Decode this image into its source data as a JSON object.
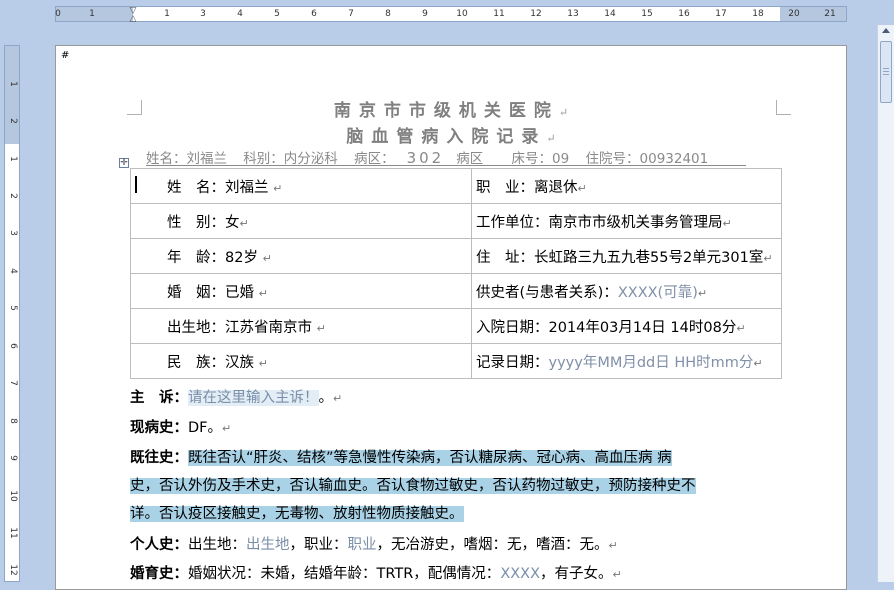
{
  "ruler": {
    "h_numbers": [
      "0",
      "1",
      "2",
      "1",
      "2",
      "3",
      "4",
      "5",
      "6",
      "7",
      "8",
      "9",
      "10",
      "11",
      "12",
      "13",
      "14",
      "15",
      "16",
      "17",
      "18",
      "19",
      "20",
      "21"
    ],
    "v_numbers": [
      "1",
      "2",
      "1",
      "2",
      "3",
      "4",
      "5",
      "6",
      "7",
      "8",
      "9",
      "10",
      "11",
      "12",
      "13"
    ]
  },
  "page": {
    "hash": "#",
    "title_line1": "南京市市级机关医院",
    "title_line2": "脑血管病入院记录",
    "return_mark": "↵",
    "info": {
      "name": "姓名：刘福兰",
      "dept": "科别：内分泌科",
      "ward_label": "病区：",
      "ward_value": "302",
      "ward_suffix": "病区",
      "bed": "床号：09",
      "admission_no": "住院号：00932401"
    },
    "table": [
      {
        "left_label": "姓　名：",
        "left_value": "刘福兰",
        "right_label": "职　业：",
        "right_value": "离退休"
      },
      {
        "left_label": "性　别：",
        "left_value": "女",
        "right_label": "工作单位：",
        "right_value": "南京市市级机关事务管理局"
      },
      {
        "left_label": "年　龄：",
        "left_value": "82岁",
        "right_label": "住　址：",
        "right_value": "长虹路三九五九巷55号2单元301室"
      },
      {
        "left_label": "婚　姻：",
        "left_value": "已婚",
        "right_label": "供史者(与患者关系)：",
        "right_value": "XXXX(可靠)"
      },
      {
        "left_label": "出生地：",
        "left_value": "江苏省南京市",
        "right_label": "入院日期：",
        "right_value": "2014年03月14日 14时08分"
      },
      {
        "left_label": "民　族：",
        "left_value": "汉族",
        "right_label": "记录日期：",
        "right_value": "yyyy年MM月dd日 HH时mm分"
      }
    ],
    "chief_complaint": {
      "label": "主　诉：",
      "placeholder": "请在这里输入主诉！",
      "tail": "。"
    },
    "present_history": {
      "label": "现病史：",
      "value": "DF。"
    },
    "past_history": {
      "label": "既往史：",
      "line1": "既往否认“肝炎、结核”等急慢性传染病，否认糖尿病、冠心病、高血压病 病",
      "line2": "史，否认外伤及手术史，否认输血史。否认食物过敏史，否认药物过敏史，预防接种史不",
      "line3": "详。否认疫区接触史，无毒物、放射性物质接触史。"
    },
    "personal_history": {
      "label": "个人史：",
      "birthplace_label": "出生地：",
      "birthplace_value": "出生地",
      "occupation_label": "，职业：",
      "occupation_value": "职业",
      "rest": "，无冶游史，嗜烟：无，嗜酒：无。"
    },
    "marital_history": {
      "label": "婚育史：",
      "text1": "婚姻状况：未婚，结婚年龄：TRTR，配偶情况：",
      "spouse_value": "XXXX",
      "text2": "，有子女。"
    }
  }
}
